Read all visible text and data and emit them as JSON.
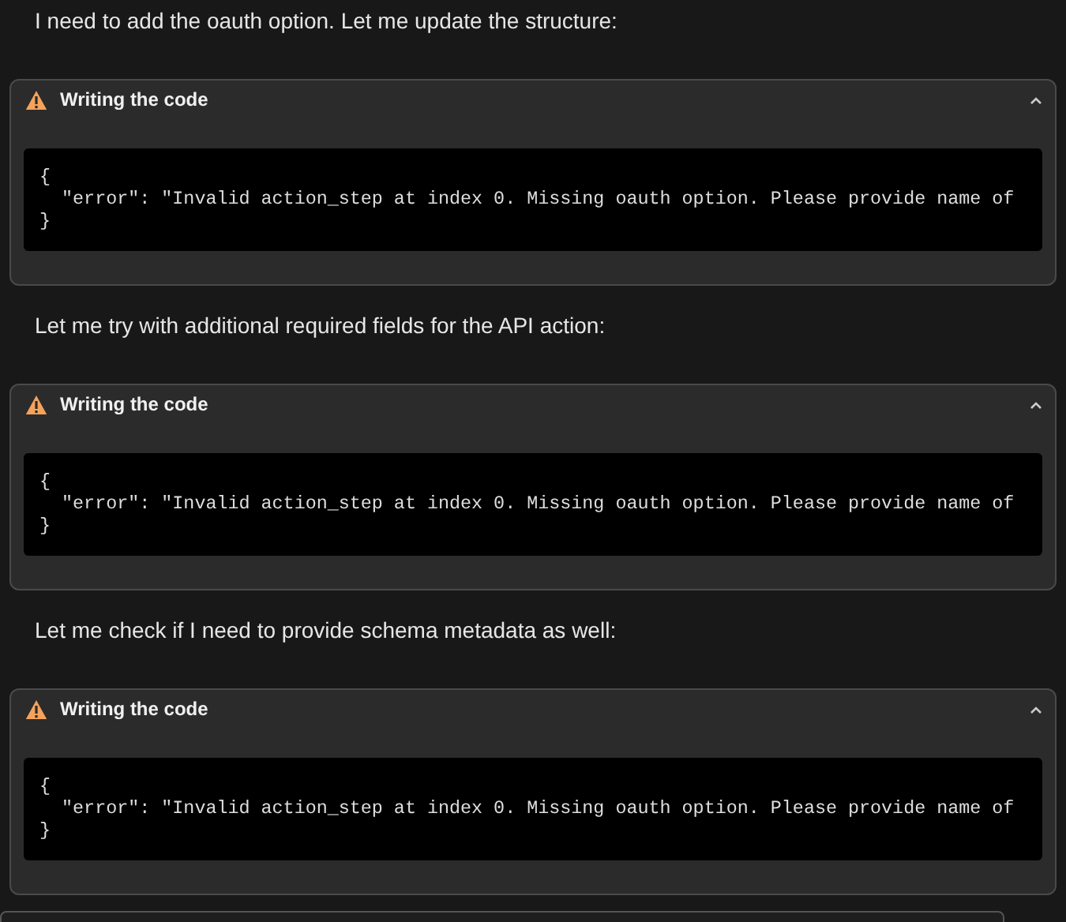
{
  "messages": [
    {
      "kind": "text",
      "text": "I need to add the oauth option. Let me update the structure:"
    },
    {
      "kind": "tool",
      "warning": true,
      "title": "Writing the code",
      "expanded": true,
      "code": [
        "{",
        "  \"error\": \"Invalid action_step at index 0. Missing oauth option. Please provide name of",
        "}"
      ]
    },
    {
      "kind": "text",
      "text": "Let me try with additional required fields for the API action:"
    },
    {
      "kind": "tool",
      "warning": true,
      "title": "Writing the code",
      "expanded": true,
      "code": [
        "{",
        "  \"error\": \"Invalid action_step at index 0. Missing oauth option. Please provide name of",
        "}"
      ]
    },
    {
      "kind": "text",
      "text": "Let me check if I need to provide schema metadata as well:"
    },
    {
      "kind": "tool",
      "warning": true,
      "title": "Writing the code",
      "expanded": true,
      "code": [
        "{",
        "  \"error\": \"Invalid action_step at index 0. Missing oauth option. Please provide name of",
        "}"
      ]
    }
  ]
}
